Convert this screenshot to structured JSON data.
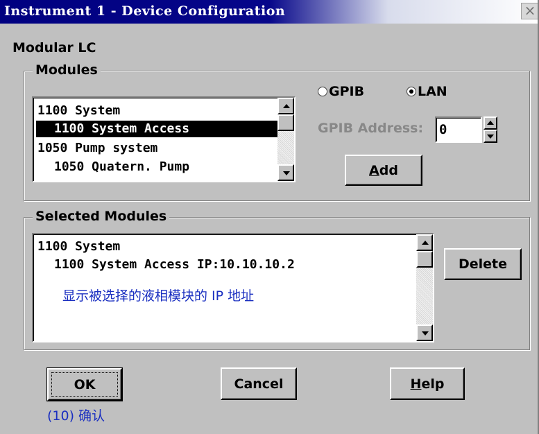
{
  "window": {
    "title": "Instrument 1 - Device Configuration",
    "close_glyph": "×"
  },
  "app_title": "Modular LC",
  "modules_group": {
    "label": "Modules",
    "list_items": [
      {
        "text": "1100 System",
        "indent": false,
        "selected": false
      },
      {
        "text": "1100 System Access",
        "indent": true,
        "selected": true
      },
      {
        "text": "1050 Pump system",
        "indent": false,
        "selected": false
      },
      {
        "text": "1050 Quatern. Pump",
        "indent": true,
        "selected": false
      }
    ],
    "connection": {
      "gpib_label": "GPIB",
      "lan_label": "LAN",
      "selected": "LAN"
    },
    "gpib_address_label": "GPIB Address:",
    "gpib_address_value": "0",
    "add_button": {
      "mnemonic": "A",
      "rest": "dd"
    }
  },
  "selected_group": {
    "label": "Selected Modules",
    "list_items": [
      {
        "text": "1100 System",
        "indent": false
      },
      {
        "text": "1100 System Access IP:10.10.10.2",
        "indent": true
      }
    ],
    "annotation": "显示被选择的液相模块的 IP 地址",
    "delete_button": "Delete"
  },
  "buttons": {
    "ok": "OK",
    "cancel": "Cancel",
    "help": {
      "mnemonic": "H",
      "rest": "elp"
    }
  },
  "ok_annotation": "(10) 确认",
  "colors": {
    "titlebar": "#000080",
    "dialog_bg": "#c0c0c0",
    "annotation_blue": "#1a2fc0"
  }
}
